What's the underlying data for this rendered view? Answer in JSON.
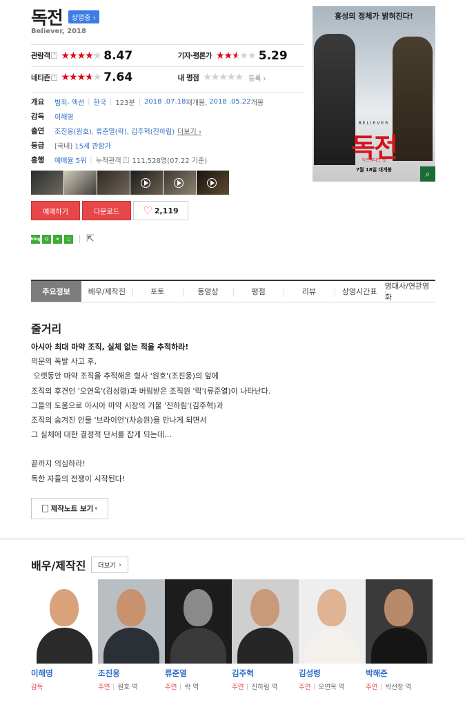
{
  "movie": {
    "title": "독전",
    "status_badge": "상영중 ›",
    "subtitle": "Believer, 2018"
  },
  "ratings": {
    "audience": {
      "label": "관람객",
      "score": "8.47",
      "stars": 4.2
    },
    "critics": {
      "label": "기자·평론가",
      "score": "5.29",
      "stars": 2.6
    },
    "netizen": {
      "label": "네티즌",
      "score": "7.64",
      "stars": 3.8
    },
    "mine": {
      "label": "내 평점",
      "stars": 0,
      "register": "등록 ›"
    }
  },
  "info": {
    "overview_label": "개요",
    "genre1": "범죄",
    "genre2": "액션",
    "country": "한국",
    "runtime": "123분",
    "release1": "2018 .07.18",
    "release1_suffix": "재개봉,",
    "release2": "2018 .05.22",
    "release2_suffix": "개봉",
    "director_label": "감독",
    "director": "이해영",
    "cast_label": "출연",
    "cast_text": "조진웅(원호), 류준열(락), 김주혁(진하림)",
    "cast_more": "더보기 ›",
    "rating_label": "등급",
    "rating_prefix": "[국내]",
    "rating_value": "15세 관람가",
    "boxoffice_label": "흥행",
    "rank": "예매율 5위",
    "cumulative_label": "누적관객",
    "cumulative_value": "111,528명",
    "cumulative_date": "(07.22 기준)"
  },
  "buttons": {
    "reserve": "예매하기",
    "download": "다운로드",
    "like_count": "2,119"
  },
  "share": {
    "blog": "blog"
  },
  "poster": {
    "tagline": "흥성의 정체가 밝혀진다!",
    "believer": "BELIEVER",
    "title": "독전",
    "subtitle": "익스텐디드 컷",
    "date": "7월 18일 대개봉"
  },
  "tabs": [
    "주요정보",
    "배우/제작진",
    "포토",
    "동영상",
    "평점",
    "리뷰",
    "상영시간표",
    "명대사/연관영화"
  ],
  "story": {
    "heading": "줄거리",
    "lead": "아시아 최대 마약 조직, 실체 없는 적을 추적하라!",
    "lines": [
      "의문의 폭발 사고 후,",
      " 오랫동안 마약 조직을 추적해온 형사 '원호'(조진웅)의 앞에",
      "조직의 후견인 '오연옥'(김성령)과 버림받은 조직원 '락'(류준열)이 나타난다.",
      "그들의 도움으로 아시아 마약 시장의 거물 '진하림'(김주혁)과",
      "조직의 숨겨진 인물 '브라이언'(차승원)을 만나게 되면서",
      "그 실체에 대한 결정적 단서를 잡게 되는데…",
      "",
      "끝까지 의심하라!",
      "독한 자들의 전쟁이 시작된다!"
    ],
    "note_button": "제작노트 보기"
  },
  "cast_section": {
    "heading": "배우/제작진",
    "more": "더보기",
    "people": [
      {
        "name": "이해영",
        "type": "감독",
        "role": ""
      },
      {
        "name": "조진웅",
        "type": "주연",
        "role": "원호 역"
      },
      {
        "name": "류준열",
        "type": "주연",
        "role": "락 역"
      },
      {
        "name": "김주혁",
        "type": "주연",
        "role": "진하림 역"
      },
      {
        "name": "김성령",
        "type": "주연",
        "role": "오연옥 역"
      },
      {
        "name": "박해준",
        "type": "주연",
        "role": "박선창 역"
      }
    ]
  },
  "colors": {
    "accent_red": "#e8474a",
    "link_blue": "#2d6cc8",
    "star_red": "#e60012"
  }
}
